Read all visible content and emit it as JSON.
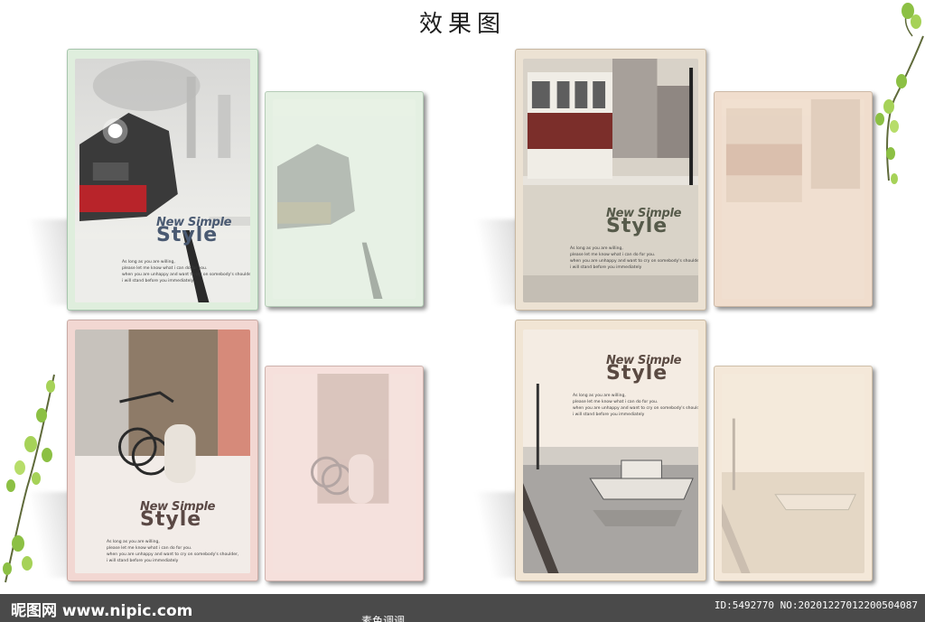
{
  "page": {
    "title": "效果图"
  },
  "cover": {
    "cn_small": "素色调调",
    "line1": "New Simple",
    "line2": "Style",
    "blurb": [
      "As long as you are willing,",
      "please let me know what i can do for you.",
      "when you are unhappy and want to cry on somebody's shoulder,",
      "i will stand before you immediately"
    ]
  },
  "colors": {
    "mint": "#dfeedd",
    "beige": "#ece2d3",
    "pink": "#f2d7d2",
    "cream": "#f1e5d4"
  },
  "footer": {
    "logo": "昵图网 www.nipic.com",
    "id": "ID:5492770 NO:20201227012200504087",
    "caption": "素色调调"
  },
  "icons": [
    "leaf-vine-icon"
  ]
}
